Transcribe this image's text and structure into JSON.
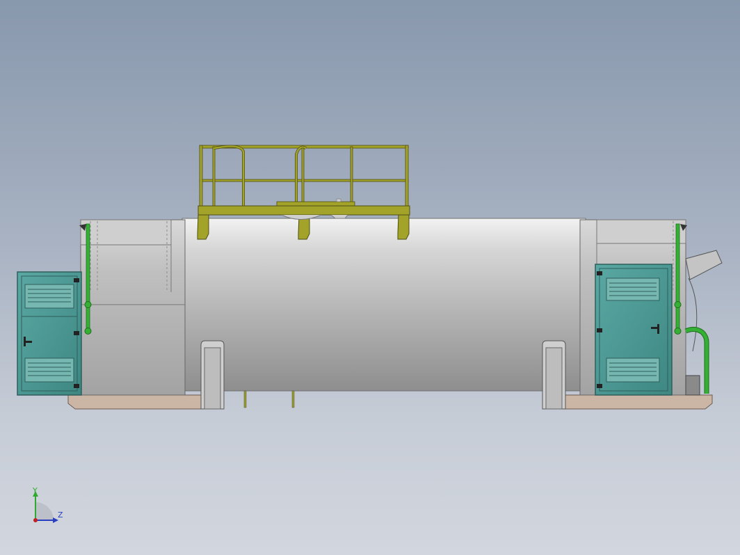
{
  "viewport": {
    "background_top": "#8898ad",
    "background_bottom": "#d2d6de"
  },
  "colors": {
    "tank_body": "#b8b8b8",
    "platform_frame": "#9a9a25",
    "door_panel": "#4f9a96",
    "pipe": "#35b035",
    "base_slab": "#c9b5a5"
  },
  "triad": {
    "y_label": "Y",
    "z_label": "Z",
    "y_color": "#2faa2f",
    "z_color": "#2a3fbf",
    "x_color": "#c02020"
  },
  "model": {
    "name_icon": "tank-assembly-icon",
    "left_door_icon": "vented-door-icon",
    "right_door_icon": "vented-door-icon",
    "platform_icon": "railing-platform-icon"
  }
}
